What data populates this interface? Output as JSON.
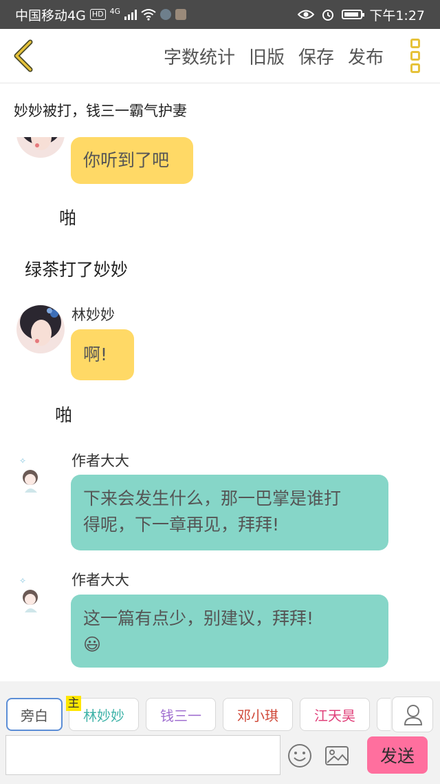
{
  "status": {
    "carrier": "中国移动4G",
    "hd": "HD",
    "net": "4G",
    "time": "下午1:27"
  },
  "nav": {
    "word_count": "字数统计",
    "old_version": "旧版",
    "save": "保存",
    "publish": "发布"
  },
  "chapter": {
    "title": "妙妙被打，钱三一霸气护妻"
  },
  "messages": {
    "m1": {
      "text": "你听到了吧"
    },
    "n1": {
      "text": "啪"
    },
    "n2": {
      "text": "绿茶打了妙妙"
    },
    "m2": {
      "name": "林妙妙",
      "text": "啊!"
    },
    "n3": {
      "text": "啪"
    },
    "m3": {
      "name": "作者大大",
      "line1": "下来会发生什么，那一巴掌是谁打",
      "line2": "得呢，下一章再见，拜拜!"
    },
    "m4": {
      "name": "作者大大",
      "line1": "这一篇有点少，别建议，拜拜!",
      "emoji": "😃"
    }
  },
  "roles": {
    "narrator": "旁白",
    "main_tag": "主",
    "r1": "林妙妙",
    "r2": "钱三一",
    "r3": "邓小琪",
    "r4": "江天昊"
  },
  "input": {
    "placeholder": ""
  },
  "send_label": "发送",
  "colors": {
    "yellow_bubble": "#ffd966",
    "teal_bubble": "#86d6c8",
    "send_button": "#ff6f9e",
    "accent": "#e6c23a",
    "role_r1": "#3fb3a8",
    "role_r2": "#a06fd0",
    "role_r3": "#d04a3a",
    "role_r4": "#e0407a"
  }
}
